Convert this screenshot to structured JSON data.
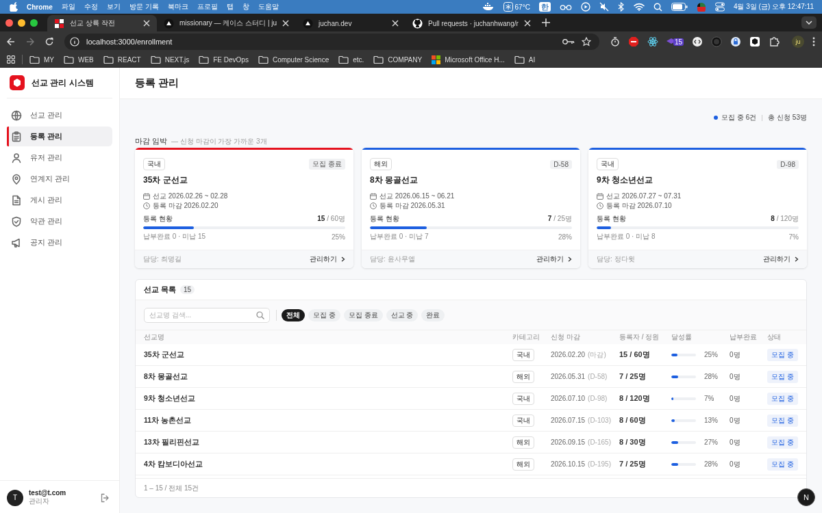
{
  "menubar": {
    "app": "Chrome",
    "menus": [
      "파일",
      "수정",
      "보기",
      "방문 기록",
      "북마크",
      "프로필",
      "탭",
      "창",
      "도움말"
    ],
    "temperature": "67°C",
    "input_method": "한",
    "clock": "4월 3일 (금) 오후 12:47:11"
  },
  "browser": {
    "tabs": [
      {
        "title": "선교 상륙 작전",
        "selected": true
      },
      {
        "title": "missionary — 케이스 스터디 | ju",
        "selected": false
      },
      {
        "title": "juchan.dev",
        "selected": false
      },
      {
        "title": "Pull requests · juchanhwang/r",
        "selected": false
      }
    ],
    "url": "localhost:3000/enrollment",
    "extension_badge": "15",
    "profile": "ju",
    "bookmarks": [
      {
        "label": "MY",
        "kind": "folder"
      },
      {
        "label": "WEB",
        "kind": "folder"
      },
      {
        "label": "REACT",
        "kind": "folder"
      },
      {
        "label": "NEXT.js",
        "kind": "folder"
      },
      {
        "label": "FE DevOps",
        "kind": "folder"
      },
      {
        "label": "Computer Science",
        "kind": "folder"
      },
      {
        "label": "etc.",
        "kind": "folder"
      },
      {
        "label": "COMPANY",
        "kind": "folder"
      },
      {
        "label": "Microsoft Office H...",
        "kind": "app"
      },
      {
        "label": "AI",
        "kind": "folder"
      }
    ]
  },
  "sidebar": {
    "brand": "선교 관리 시스템",
    "items": [
      {
        "label": "선교 관리",
        "selected": false
      },
      {
        "label": "등록 관리",
        "selected": true
      },
      {
        "label": "유저 관리",
        "selected": false
      },
      {
        "label": "연계지 관리",
        "selected": false
      },
      {
        "label": "게시 관리",
        "selected": false
      },
      {
        "label": "약관 관리",
        "selected": false
      },
      {
        "label": "공지 관리",
        "selected": false
      }
    ],
    "user": {
      "initial": "T",
      "email": "test@t.com",
      "role": "관리자"
    }
  },
  "page_title": "등록 관리",
  "summary": {
    "recruiting": "모집 중 6건",
    "total": "총 신청 53명"
  },
  "urgent": {
    "title": "마감 임박",
    "subtitle": "— 신청 마감이 가장 가까운 3개"
  },
  "cards": [
    {
      "category": "국내",
      "badge": "모집 종료",
      "name": "35차 군선교",
      "dates": "선교 2026.02.26 ~ 02.28",
      "deadline": "등록 마감 2026.02.20",
      "progress_label": "등록 현황",
      "count": "15",
      "capacity": "/ 60명",
      "level": 0.25,
      "payment": "납부완료 0 · 미납 15",
      "percent": "25%",
      "manager": "담당: 최명길",
      "action": "관리하기",
      "color": "#e5121e"
    },
    {
      "category": "해외",
      "badge": "D-58",
      "name": "8차 몽골선교",
      "dates": "선교 2026.06.15 ~ 06.21",
      "deadline": "등록 마감 2026.05.31",
      "progress_label": "등록 현황",
      "count": "7",
      "capacity": "/ 25명",
      "level": 0.28,
      "payment": "납부완료 0 · 미납 7",
      "percent": "28%",
      "manager": "담당: 윤사무엘",
      "action": "관리하기",
      "color": "#1d5fe0"
    },
    {
      "category": "국내",
      "badge": "D-98",
      "name": "9차 청소년선교",
      "dates": "선교 2026.07.27 ~ 07.31",
      "deadline": "등록 마감 2026.07.10",
      "progress_label": "등록 현황",
      "count": "8",
      "capacity": "/ 120명",
      "level": 0.07,
      "payment": "납부완료 0 · 미납 8",
      "percent": "7%",
      "manager": "담당: 정다윗",
      "action": "관리하기",
      "color": "#1d5fe0"
    }
  ],
  "table": {
    "title": "선교 목록",
    "count": "15",
    "search_placeholder": "선교명 검색...",
    "filters": [
      {
        "label": "전체",
        "selected": true
      },
      {
        "label": "모집 중",
        "selected": false
      },
      {
        "label": "모집 종료",
        "selected": false
      },
      {
        "label": "선교 중",
        "selected": false
      },
      {
        "label": "완료",
        "selected": false
      }
    ],
    "columns": [
      "선교명",
      "카테고리",
      "신청 마감",
      "등록자 / 정원",
      "달성률",
      "납부완료",
      "상태"
    ],
    "rows": [
      {
        "name": "35차 군선교",
        "category": "국내",
        "deadline": "2026.02.20",
        "dday": "(마감)",
        "enrolled": "15 / 60명",
        "level": 0.25,
        "rate": "25%",
        "paid": "0명",
        "status": "모집 중"
      },
      {
        "name": "8차 몽골선교",
        "category": "해외",
        "deadline": "2026.05.31",
        "dday": "(D-58)",
        "enrolled": "7 / 25명",
        "level": 0.28,
        "rate": "28%",
        "paid": "0명",
        "status": "모집 중"
      },
      {
        "name": "9차 청소년선교",
        "category": "국내",
        "deadline": "2026.07.10",
        "dday": "(D-98)",
        "enrolled": "8 / 120명",
        "level": 0.07,
        "rate": "7%",
        "paid": "0명",
        "status": "모집 중"
      },
      {
        "name": "11차 농촌선교",
        "category": "국내",
        "deadline": "2026.07.15",
        "dday": "(D-103)",
        "enrolled": "8 / 60명",
        "level": 0.13,
        "rate": "13%",
        "paid": "0명",
        "status": "모집 중"
      },
      {
        "name": "13차 필리핀선교",
        "category": "해외",
        "deadline": "2026.09.15",
        "dday": "(D-165)",
        "enrolled": "8 / 30명",
        "level": 0.27,
        "rate": "27%",
        "paid": "0명",
        "status": "모집 중"
      },
      {
        "name": "4차 캄보디아선교",
        "category": "해외",
        "deadline": "2026.10.15",
        "dday": "(D-195)",
        "enrolled": "7 / 25명",
        "level": 0.28,
        "rate": "28%",
        "paid": "0명",
        "status": "모집 중"
      }
    ],
    "footer": "1 – 15 / 전체 15건"
  },
  "dev_indicator": "N"
}
